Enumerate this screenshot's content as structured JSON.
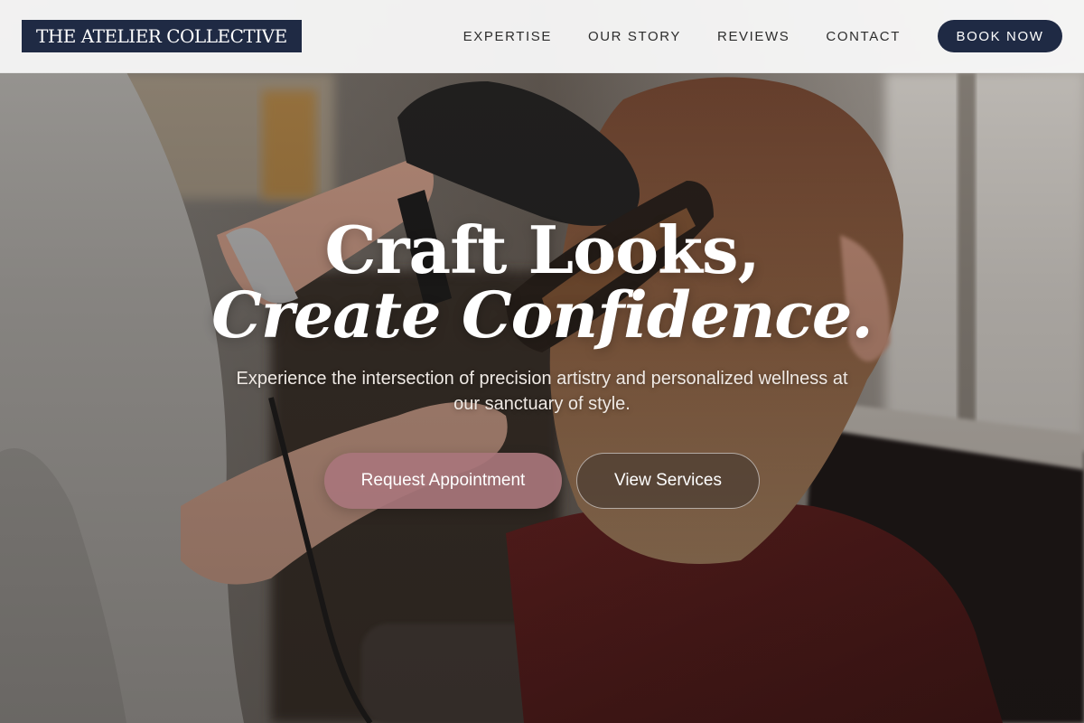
{
  "header": {
    "logo_text": "THE ATELIER COLLECTIVE",
    "nav": [
      {
        "label": "EXPERTISE"
      },
      {
        "label": "OUR STORY"
      },
      {
        "label": "REVIEWS"
      },
      {
        "label": "CONTACT"
      }
    ],
    "cta_label": "BOOK NOW"
  },
  "hero": {
    "headline_line1": "Craft Looks,",
    "headline_line2": "Create Confidence.",
    "subtext": "Experience the intersection of precision artistry and personalized wellness at our sanctuary of style.",
    "primary_button": "Request Appointment",
    "secondary_button": "View Services",
    "background_image": "hair-stylist-blow-drying-client-photo"
  },
  "colors": {
    "brand_navy": "#1f2a44",
    "accent_rose": "#a8757b",
    "header_bg": "#f7f7f7",
    "nav_text": "#2d2d2d"
  }
}
